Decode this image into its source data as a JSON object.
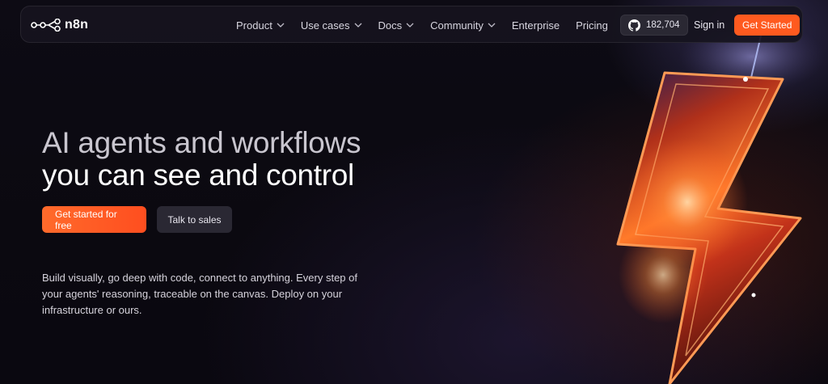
{
  "brand": {
    "name": "n8n",
    "accent_color": "#ff5a1f"
  },
  "nav": {
    "items": [
      {
        "label": "Product",
        "has_dropdown": true
      },
      {
        "label": "Use cases",
        "has_dropdown": true
      },
      {
        "label": "Docs",
        "has_dropdown": true
      },
      {
        "label": "Community",
        "has_dropdown": true
      },
      {
        "label": "Enterprise",
        "has_dropdown": false
      },
      {
        "label": "Pricing",
        "has_dropdown": false
      }
    ],
    "github": {
      "icon": "github-icon",
      "stars": "182,704"
    },
    "sign_in": "Sign in",
    "get_started": "Get Started"
  },
  "hero": {
    "title_line1": "AI agents and workflows",
    "title_line2": "you can see and control",
    "primary_cta": "Get started for free",
    "secondary_cta": "Talk to sales",
    "description": "Build visually, go deep with code, connect to anything. Every step of your agents' reasoning, traceable on the canvas. Deploy on your infrastructure or ours.",
    "illustration": "lightning-bolt-illustration"
  }
}
